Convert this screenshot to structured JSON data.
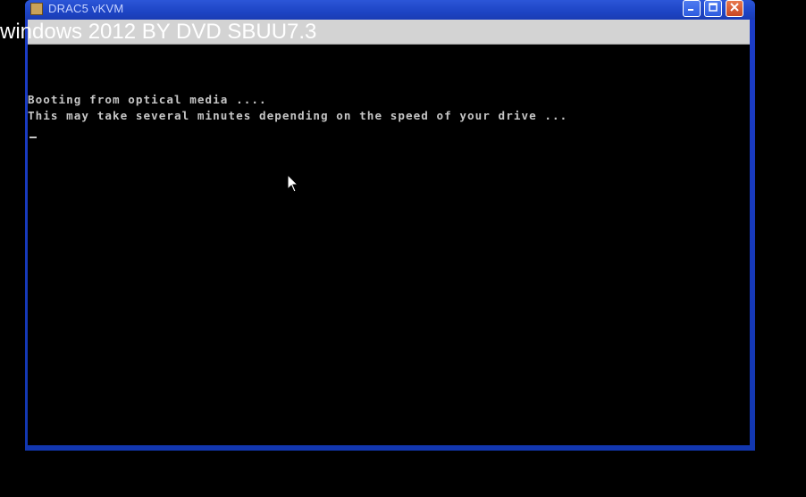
{
  "window": {
    "title": "DRAC5 vKVM"
  },
  "caption": {
    "text": "windows 2012 BY DVD SBUU7.3"
  },
  "console": {
    "lines": [
      "Booting from optical media ....",
      "This may take several minutes depending on the speed of your drive ..."
    ]
  },
  "icons": {
    "app": "kvm-app-icon",
    "minimize": "minimize-icon",
    "maximize": "maximize-icon",
    "close": "close-icon",
    "pointer": "mouse-pointer-icon"
  },
  "colors": {
    "titlebar": "#1d44c4",
    "console_bg": "#000000",
    "console_text": "#c6c6c6",
    "caption_text": "#ffffff",
    "close_button": "#c84622"
  }
}
